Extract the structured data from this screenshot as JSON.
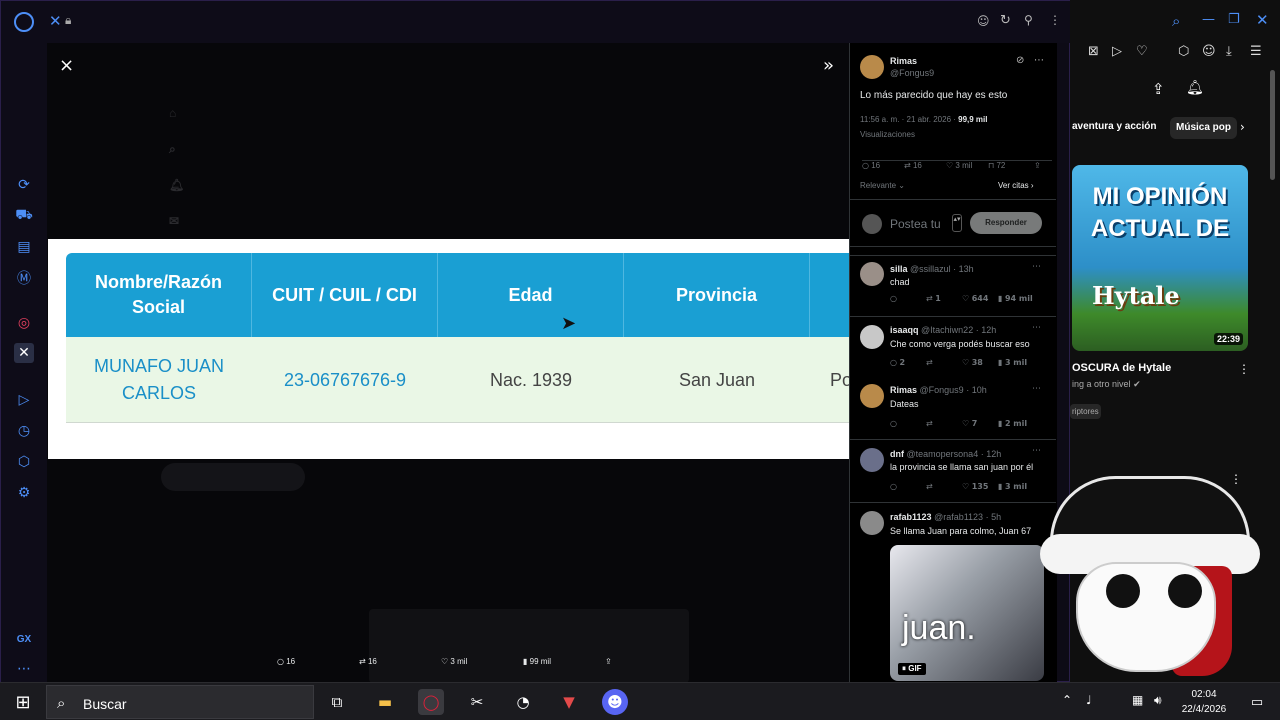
{
  "browser": {
    "tab_icon": "x-logo-icon",
    "titlebar_icons": [
      "emoji-icon",
      "refresh-icon",
      "pin-icon",
      "menu-dots-icon"
    ],
    "sidebar_icons": [
      "aria-icon",
      "shopping-icon",
      "player-icon",
      "music-icon",
      "instagram-icon",
      "x-icon",
      "play-icon",
      "history-icon",
      "extensions-icon",
      "settings-icon"
    ],
    "sidebar_footer": "GX"
  },
  "modal": {
    "close_glyph": "×",
    "expand_glyph": "»",
    "headers": [
      "Nombre/Razón Social",
      "CUIT / CUIL / CDI",
      "Edad",
      "Provincia"
    ],
    "row": [
      "MUNAFO JUAN CARLOS",
      "23-06767676-9",
      "Nac. 1939",
      "San Juan",
      "Po"
    ],
    "accent": "#1a9fd3"
  },
  "bottom_bar": {
    "replies": "16",
    "reposts": "16",
    "likes": "3 mil",
    "views": "99 mil"
  },
  "post": {
    "author": "Rimas",
    "handle": "@Fongus9",
    "text": "Lo más parecido que hay es esto",
    "time": "11:56 a. m. · 21 abr. 2026 · ",
    "views_count": "99,9 mil",
    "views_label": "Visualizaciones",
    "stats": {
      "replies": "16",
      "reposts": "16",
      "likes": "3 mil",
      "bookmarks": "72"
    },
    "sort": "Relevante",
    "quotes": "Ver citas",
    "reply_placeholder": "Postea tu",
    "reply_button": "Responder"
  },
  "replies": [
    {
      "name": "silla",
      "handle": "@ssillazul · 13h",
      "text": "chad",
      "stats": [
        "",
        "1",
        "644",
        "94 mil"
      ]
    },
    {
      "name": "isaaqq",
      "handle": "@Itachiwn22 · 12h",
      "text": "Che como verga podés buscar eso",
      "stats": [
        "2",
        "",
        "38",
        "3 mil"
      ]
    },
    {
      "name": "Rimas",
      "handle": "@Fongus9 · 10h",
      "text": "Dateas",
      "stats": [
        "",
        "",
        "7",
        "2 mil"
      ]
    },
    {
      "name": "dnf",
      "handle": "@teamopersona4 · 12h",
      "text": "la provincia se llama san juan por él",
      "stats": [
        "",
        "",
        "135",
        "3 mil"
      ]
    },
    {
      "name": "rafab1123",
      "handle": "@rafab1123 · 5h",
      "text": "Se llama Juan para colmo, Juan 67",
      "stats": []
    }
  ],
  "gif": {
    "caption": "juan.",
    "badge": "GIF"
  },
  "youtube": {
    "chips": [
      "aventura y acción",
      "Música pop"
    ],
    "thumb_text": [
      "MI OPINIÓN",
      "ACTUAL DE",
      "Hytale"
    ],
    "duration": "22:39",
    "video_title": "OSCURA de Hytale",
    "channel": "ing a otro nivel",
    "subs": "riptores"
  },
  "taskbar": {
    "search_placeholder": "Buscar",
    "time": "02:04",
    "date": "22/4/2026"
  }
}
